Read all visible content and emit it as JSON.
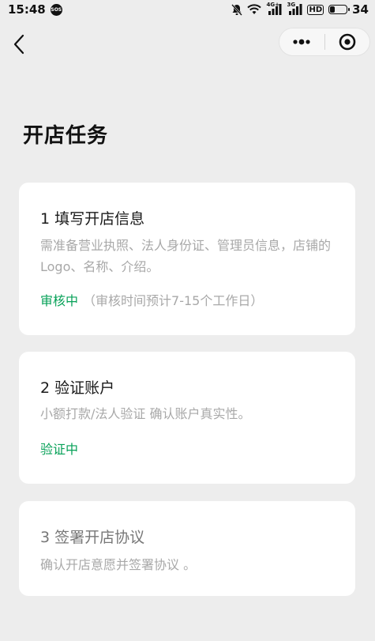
{
  "status_bar": {
    "time": "15:48",
    "sos": "SOS",
    "network_1": "4G+",
    "network_2": "3G",
    "hd": "HD",
    "battery_level": "34"
  },
  "nav": {
    "back_icon": "chevron-left-icon",
    "more_icon": "more-dots-icon",
    "close_icon": "target-close-icon"
  },
  "page": {
    "title": "开店任务"
  },
  "tasks": [
    {
      "title": "1 填写开店信息",
      "description": "需准备营业执照、法人身份证、管理员信息，店铺的Logo、名称、介绍。",
      "status": "审核中",
      "status_hint": "（审核时间预计7-15个工作日）"
    },
    {
      "title": "2 验证账户",
      "description": "小额打款/法人验证 确认账户真实性。",
      "status": "验证中"
    },
    {
      "title": "3 签署开店协议",
      "description": "确认开店意愿并签署协议 。"
    }
  ],
  "colors": {
    "background": "#ededed",
    "card": "#ffffff",
    "status_green": "#07a158",
    "muted_text": "#a8a8a8"
  }
}
